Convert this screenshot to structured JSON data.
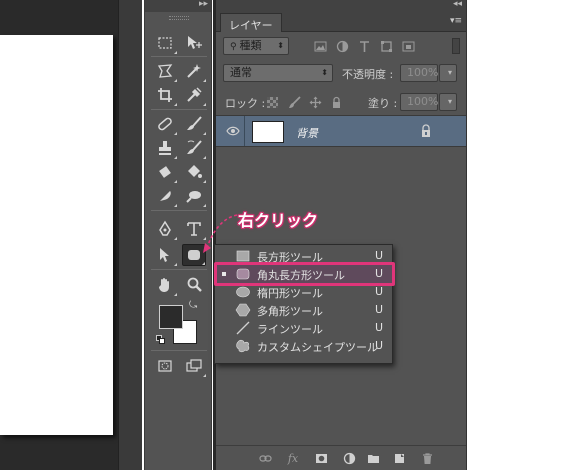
{
  "layers_panel": {
    "tab_label": "レイヤー",
    "filter_kind": "種類",
    "blend_mode": "通常",
    "opacity_label": "不透明度 :",
    "opacity_value": "100%",
    "lock_label": "ロック :",
    "fill_label": "塗り :",
    "fill_value": "100%",
    "layers": [
      {
        "name": "背景",
        "visible": true,
        "locked": true
      }
    ],
    "footer_icons": [
      "link-icon",
      "fx-icon",
      "mask-icon",
      "adjustment-icon",
      "group-folder-icon",
      "new-layer-icon",
      "trash-icon"
    ],
    "footer_fx": "fx"
  },
  "shape_flyout": {
    "items": [
      {
        "label": "長方形ツール",
        "shortcut": "U",
        "icon": "rectangle-icon",
        "active": false
      },
      {
        "label": "角丸長方形ツール",
        "shortcut": "U",
        "icon": "rounded-rectangle-icon",
        "active": true
      },
      {
        "label": "楕円形ツール",
        "shortcut": "U",
        "icon": "ellipse-icon",
        "active": false
      },
      {
        "label": "多角形ツール",
        "shortcut": "U",
        "icon": "polygon-icon",
        "active": false
      },
      {
        "label": "ラインツール",
        "shortcut": "U",
        "icon": "line-icon",
        "active": false
      },
      {
        "label": "カスタムシェイプツール",
        "shortcut": "U",
        "icon": "custom-shape-icon",
        "active": false
      }
    ]
  },
  "annotation": {
    "text": "右クリック",
    "color": "#e0357a"
  },
  "colors": {
    "panel_bg": "#535353",
    "selected_layer": "#596c82",
    "highlight": "#e0357a"
  }
}
